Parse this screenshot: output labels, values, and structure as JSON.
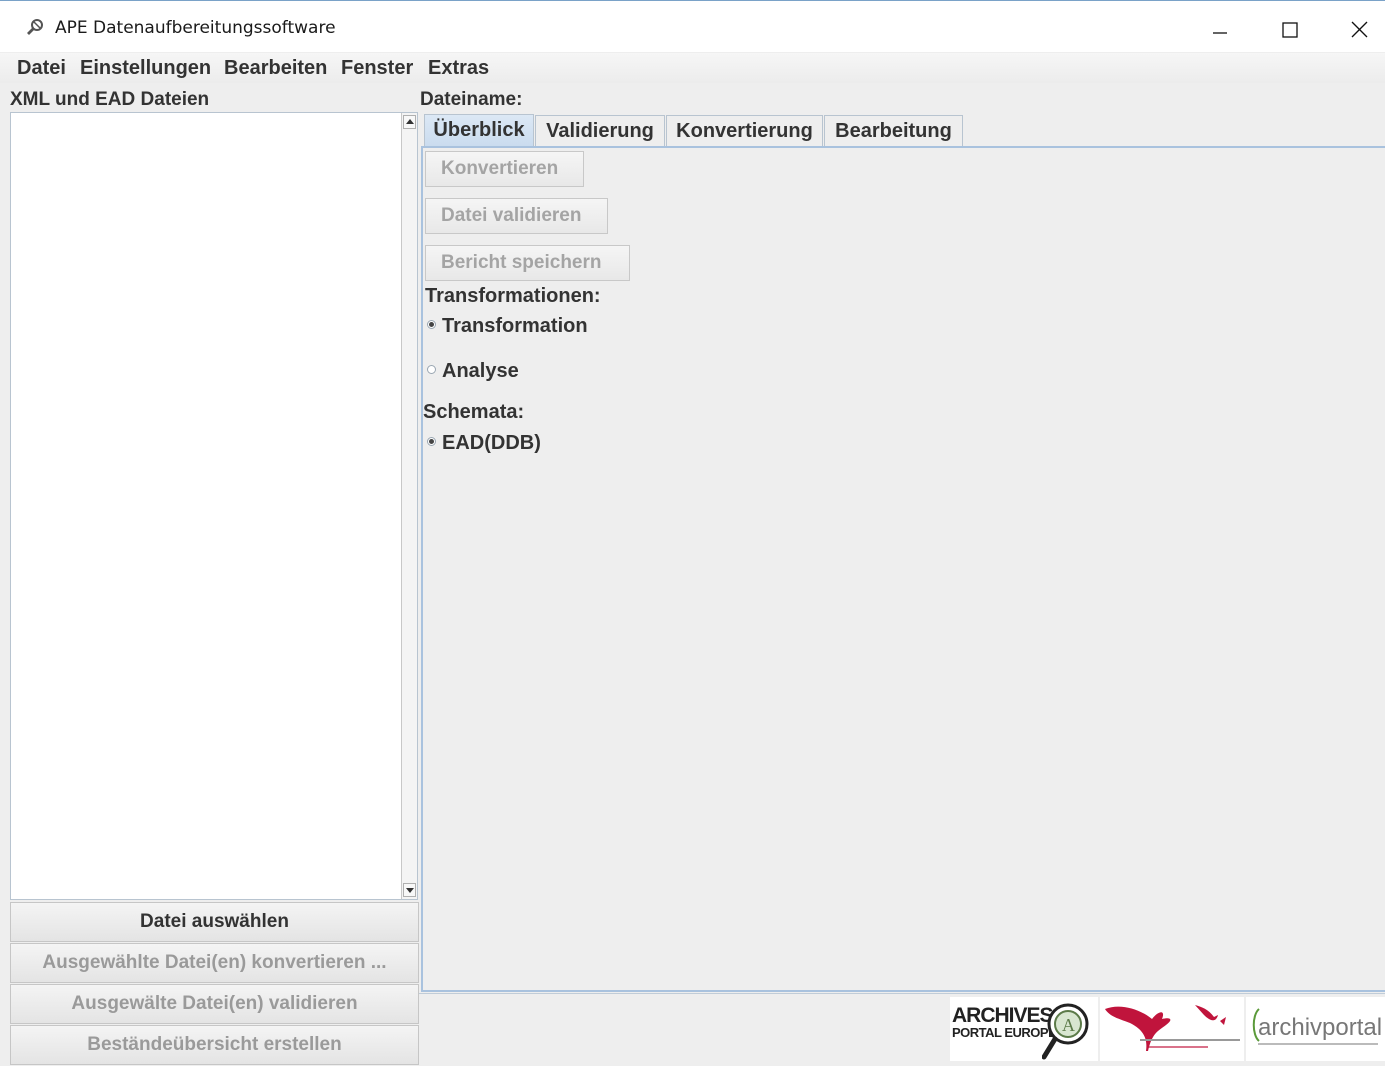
{
  "window": {
    "title": "APE Datenaufbereitungssoftware",
    "controls": [
      "minimize",
      "maximize",
      "close"
    ]
  },
  "menubar": {
    "items": [
      "Datei",
      "Einstellungen",
      "Bearbeiten",
      "Fenster",
      "Extras"
    ]
  },
  "left_panel": {
    "title": "XML und EAD Dateien",
    "files": [],
    "buttons": [
      {
        "label": "Datei auswählen",
        "enabled": true
      },
      {
        "label": "Ausgewählte Datei(en) konvertieren ...",
        "enabled": false
      },
      {
        "label": "Ausgewälte Datei(en) validieren",
        "enabled": false
      },
      {
        "label": "Beständeübersicht erstellen",
        "enabled": false
      }
    ]
  },
  "right_panel": {
    "filename_label": "Dateiname:",
    "tabs": [
      {
        "label": "Überblick",
        "active": true
      },
      {
        "label": "Validierung",
        "active": false
      },
      {
        "label": "Konvertierung",
        "active": false
      },
      {
        "label": "Bearbeitung",
        "active": false
      }
    ],
    "actions": [
      {
        "label": "Konvertieren",
        "enabled": false
      },
      {
        "label": "Datei validieren",
        "enabled": false
      },
      {
        "label": "Bericht speichern",
        "enabled": false
      }
    ],
    "transformations": {
      "label": "Transformationen:",
      "options": [
        {
          "label": "Transformation",
          "selected": true
        },
        {
          "label": "Analyse",
          "selected": false
        }
      ]
    },
    "schemata": {
      "label": "Schemata:",
      "options": [
        {
          "label": "EAD(DDB)",
          "selected": true
        }
      ]
    }
  },
  "footer_logos": {
    "ape": {
      "line1": "ARCHIVES",
      "line2": "PORTAL EUROPE"
    },
    "ddb": {
      "name": "Deutsche Digitale Bibliothek logo"
    },
    "archivportal": {
      "text": "archivportal"
    }
  },
  "colors": {
    "accent_logo_red": "#c0143c",
    "tab_active": "#c9dbee",
    "panel_border": "#a9c2de"
  }
}
